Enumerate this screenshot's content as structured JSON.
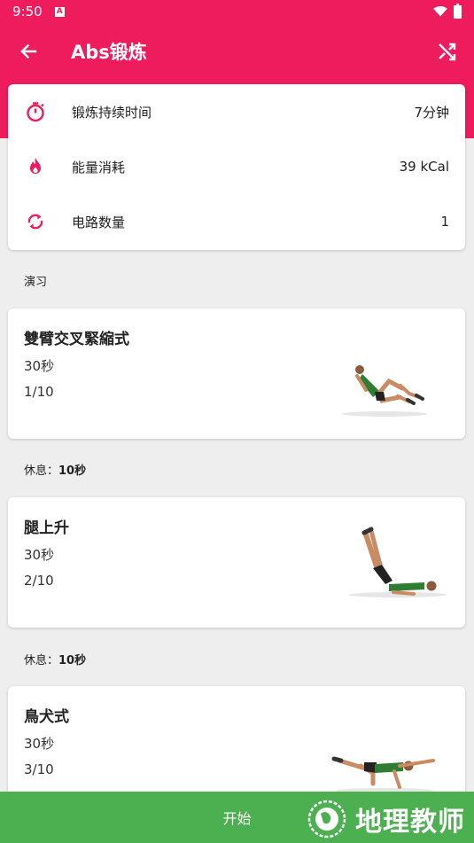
{
  "status_bar": {
    "time": "9:50",
    "notification_glyph": "A"
  },
  "app_bar": {
    "title": "Abs锻炼"
  },
  "summary": {
    "rows": [
      {
        "icon": "stopwatch-icon",
        "label": "锻炼持续时间",
        "value": "7分钟"
      },
      {
        "icon": "flame-icon",
        "label": "能量消耗",
        "value": "39 kCal"
      },
      {
        "icon": "repeat-icon",
        "label": "电路数量",
        "value": "1"
      }
    ]
  },
  "section_label": "演习",
  "exercises": [
    {
      "name": "雙臂交叉緊縮式",
      "duration": "30秒",
      "index": "1/10"
    },
    {
      "name": "腿上升",
      "duration": "30秒",
      "index": "2/10"
    },
    {
      "name": "鳥犬式",
      "duration": "30秒",
      "index": "3/10"
    }
  ],
  "rests": [
    {
      "label": "休息：",
      "value": "10秒"
    },
    {
      "label": "休息：",
      "value": "10秒"
    }
  ],
  "bottom": {
    "start_label": "开始"
  },
  "watermark": {
    "text": "地理教师"
  },
  "colors": {
    "primary": "#ee1b5d",
    "accent_green": "#4caf50",
    "background": "#eeeeee"
  }
}
